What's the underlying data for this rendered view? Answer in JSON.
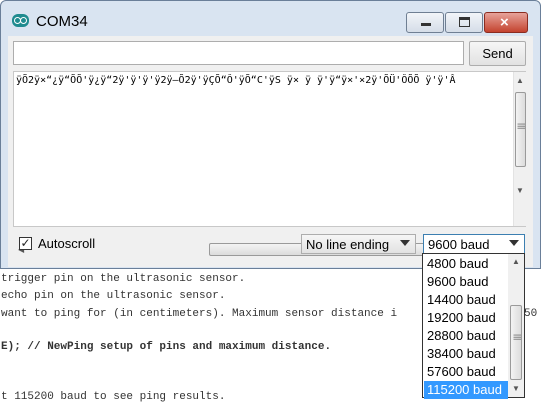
{
  "window": {
    "title": "COM34",
    "minimize_symbol": "",
    "close_symbol": "×"
  },
  "send": {
    "input_value": "",
    "button_label": "Send"
  },
  "output": {
    "text": "ÿÕ2ÿ×“¿ÿ“ÕÕ'ÿ¿ÿ“2ÿ'ÿ'ÿ'ÿ2ÿ–Õ2ÿ'ÿÇÕ“Ô'ÿÕ“C'ÿS ÿ× ÿ ÿ'ÿ“ÿ×'×2ÿ'ÕÜ'ÔÕÕ ÿ'ÿ'Â"
  },
  "scrollbars": {
    "up_arrow": "▲",
    "down_arrow": "▼",
    "left_arrow": "◀",
    "right_arrow": "▶",
    "grip": "|||"
  },
  "autoscroll": {
    "label": "Autoscroll",
    "checked": true,
    "check_mark": "✓"
  },
  "line_ending": {
    "selected": "No line ending"
  },
  "baud": {
    "selected": "9600 baud",
    "options": [
      "4800 baud",
      "9600 baud",
      "14400 baud",
      "19200 baud",
      "28800 baud",
      "38400 baud",
      "57600 baud",
      "115200 baud"
    ],
    "highlighted": "115200 baud"
  },
  "code": {
    "lines": [
      "trigger pin on the ultrasonic sensor.",
      "echo pin on the ultrasonic sensor.",
      "want to ping for (in centimeters). Maximum sensor distance i",
      "50",
      "E); // NewPing setup of pins and maximum distance.",
      "t 115200 baud to see ping results."
    ]
  }
}
